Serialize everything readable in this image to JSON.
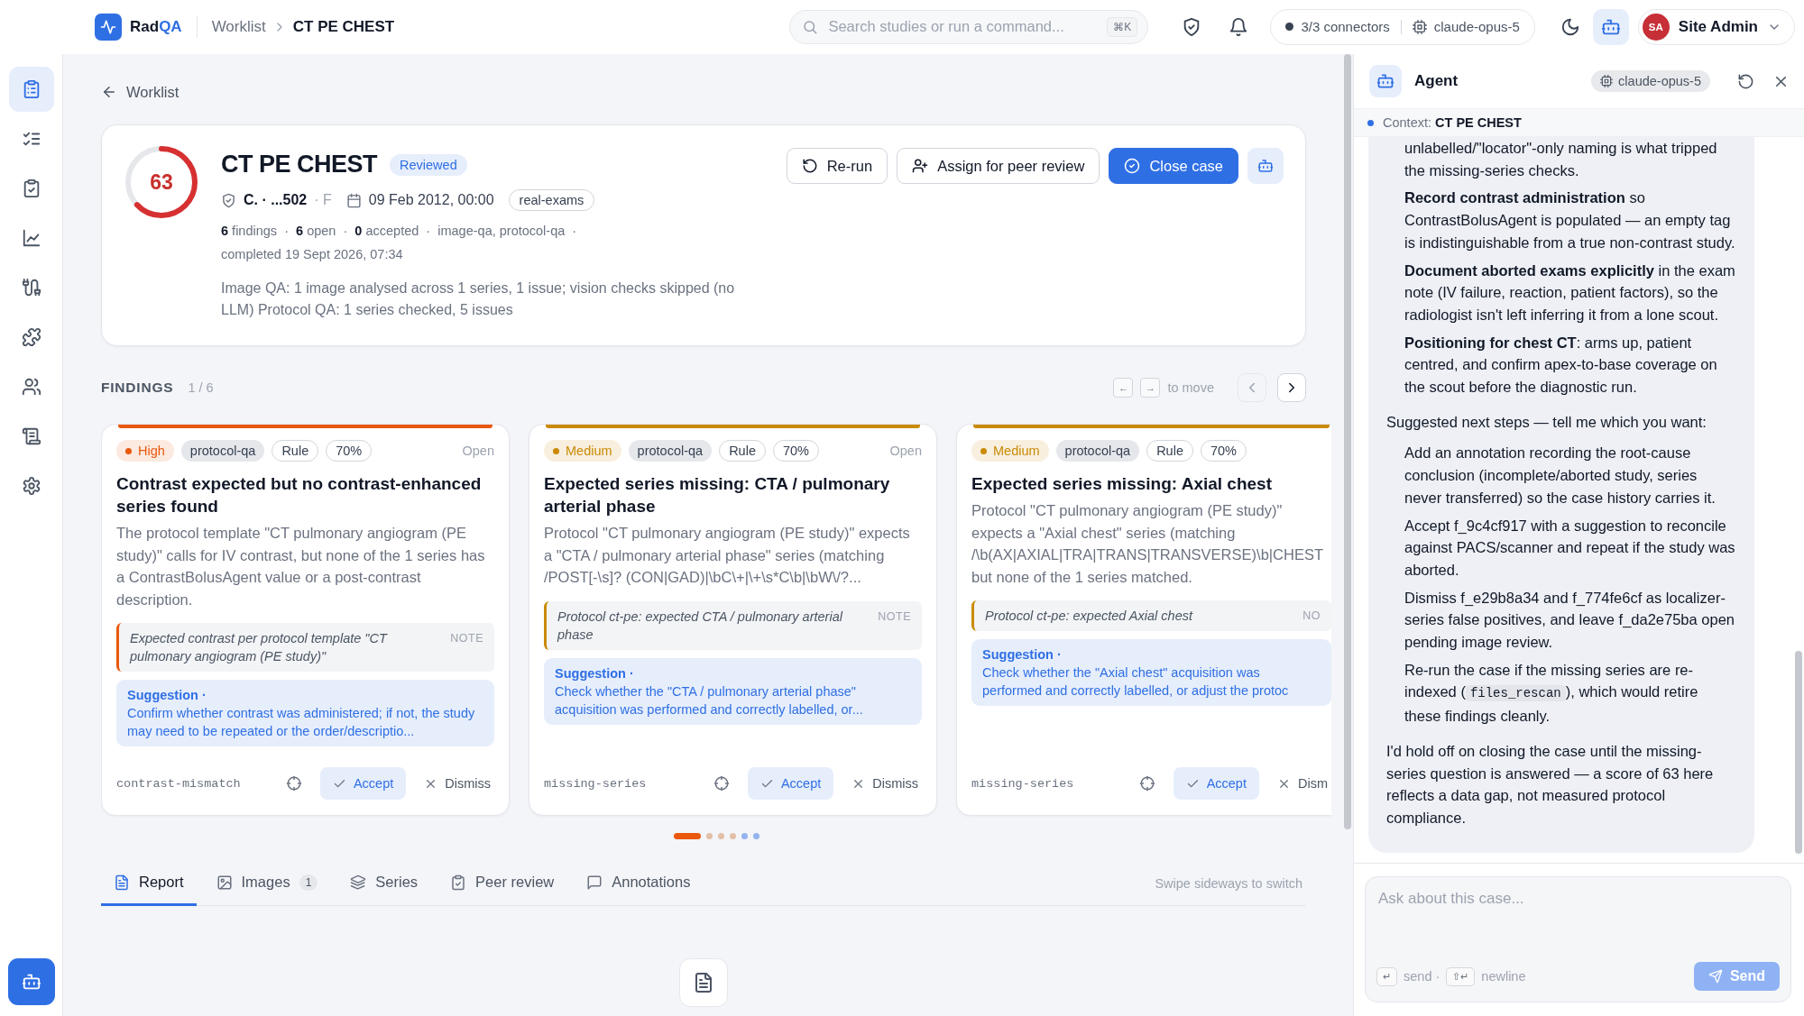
{
  "topbar": {
    "brand": {
      "text": "Rad",
      "accent": "QA"
    },
    "breadcrumb": [
      {
        "label": "Worklist",
        "current": false
      },
      {
        "label": "CT PE CHEST",
        "current": true
      }
    ],
    "search": {
      "placeholder": "Search studies or run a command...",
      "shortcut": "⌘K"
    },
    "connectors": {
      "status": "3/3 connectors",
      "model": "claude-opus-5"
    },
    "agent_toggle": {
      "on": true
    },
    "user": {
      "initials": "SA",
      "name": "Site Admin"
    }
  },
  "sidebar": {
    "items": [
      {
        "kind": "worklist",
        "selected": true
      },
      {
        "kind": "tasks",
        "selected": false
      },
      {
        "kind": "review",
        "selected": false
      },
      {
        "kind": "analytics",
        "selected": false
      },
      {
        "kind": "connectors",
        "selected": false
      },
      {
        "kind": "plugins",
        "selected": false
      },
      {
        "kind": "users",
        "selected": false
      },
      {
        "kind": "audit",
        "selected": false
      },
      {
        "kind": "settings",
        "selected": false
      }
    ]
  },
  "case": {
    "back": "Worklist",
    "score": {
      "value": "63",
      "level": 0.63
    },
    "title": "CT PE CHEST",
    "status": "Reviewed",
    "patient": "C. · ...502",
    "sex": "· F",
    "date": "09 Feb 2012, 00:00",
    "tag": "real-exams",
    "stats": "**6** findings  ·  **6** open  ·  **0** accepted  ·  image-qa, protocol-qa  ·",
    "completed": "completed 19 Sept 2026, 07:34",
    "summary": "Image QA: 1 image analysed across 1 series, 1 issue; vision checks skipped (no LLM) Protocol QA: 1 series checked, 5 issues",
    "actions": [
      {
        "kind": "rerun",
        "label": "Re-run"
      },
      {
        "kind": "assign",
        "label": "Assign for peer review"
      },
      {
        "kind": "close",
        "label": "Close case"
      },
      {
        "kind": "agent"
      }
    ]
  },
  "findings": {
    "heading": "FINDINGS",
    "position": "1 / 6",
    "keys": [
      "←",
      "→"
    ],
    "keys_hint": "to move",
    "cards": [
      {
        "severity": "High",
        "color": "#ea580c",
        "source": "protocol-qa",
        "method": "Rule",
        "confidence": "70%",
        "status": "Open",
        "title": "Contrast expected but no contrast-enhanced series found",
        "description": "The protocol template \"CT pulmonary angiogram (PE study)\" calls for IV contrast, but none of the 1 series has a ContrastBolusAgent value or a post-contrast description.",
        "note": "Expected contrast per protocol template \"CT pulmonary angiogram (PE study)\"",
        "note_label": "NOTE",
        "suggestion_label": "Suggestion ·",
        "suggestion": "Confirm whether contrast was administered; if not, the study may need to be repeated or the order/descriptio...",
        "code": "contrast-mismatch",
        "accept": "Accept",
        "dismiss": "Dismiss"
      },
      {
        "severity": "Medium",
        "color": "#ca8a04",
        "source": "protocol-qa",
        "method": "Rule",
        "confidence": "70%",
        "status": "Open",
        "title": "Expected series missing: CTA / pulmonary arterial phase",
        "description": "Protocol \"CT pulmonary angiogram (PE study)\" expects a \"CTA / pulmonary arterial phase\" series (matching /POST[-\\s]? (CON|GAD)|\\bC\\+|\\+\\s*C\\b|\\bW\\/?...",
        "note": "Protocol ct-pe: expected CTA / pulmonary arterial phase",
        "note_label": "NOTE",
        "suggestion_label": "Suggestion ·",
        "suggestion": "Check whether the \"CTA / pulmonary arterial phase\" acquisition was performed and correctly labelled, or...",
        "code": "missing-series",
        "accept": "Accept",
        "dismiss": "Dismiss"
      },
      {
        "severity": "Medium",
        "color": "#ca8a04",
        "source": "protocol-qa",
        "method": "Rule",
        "confidence": "70%",
        "title": "Expected series missing: Axial chest",
        "description": "Protocol \"CT pulmonary angiogram (PE study)\" expects a \"Axial chest\" series (matching /\\b(AX|AXIAL|TRA|TRANS|TRANSVERSE)\\b|CHEST but none of the 1 series matched.",
        "note": "Protocol ct-pe: expected Axial chest",
        "note_label": "NO",
        "suggestion_label": "Suggestion ·",
        "suggestion": "Check whether the \"Axial chest\" acquisition was performed and correctly labelled, or adjust the protoc",
        "code": "missing-series",
        "accept": "Accept",
        "dismiss": "Dism"
      }
    ],
    "dots": [
      {
        "selected": true,
        "color": "#ea580c"
      },
      {
        "selected": false,
        "color": "#e2bfa6"
      },
      {
        "selected": false,
        "color": "#e2bfa6"
      },
      {
        "selected": false,
        "color": "#e2bfa6"
      },
      {
        "selected": false,
        "color": "#93b4f0"
      },
      {
        "selected": false,
        "color": "#93b4f0"
      }
    ]
  },
  "tabs": {
    "items": [
      {
        "kind": "report",
        "label": "Report",
        "selected": true
      },
      {
        "kind": "images",
        "label": "Images",
        "count": "1",
        "selected": false
      },
      {
        "kind": "series",
        "label": "Series",
        "selected": false
      },
      {
        "kind": "peer",
        "label": "Peer review",
        "selected": false
      },
      {
        "kind": "annotations",
        "label": "Annotations",
        "selected": false
      }
    ],
    "hint": "Swipe sideways to switch"
  },
  "agent": {
    "title": "Agent",
    "model": "claude-opus-5",
    "context": "Context: **CT PE CHEST**",
    "messages": [
      {
        "kind": "item",
        "text": "unlabelled/\"locator\"-only naming is what tripped the missing-series checks."
      },
      {
        "kind": "item",
        "text": "**Record contrast administration** so ContrastBolusAgent is populated — an empty tag is indistinguishable from a true non-contrast study."
      },
      {
        "kind": "item",
        "text": "**Document aborted exams explicitly** in the exam note (IV failure, reaction, patient factors), so the radiologist isn't left inferring it from a lone scout."
      },
      {
        "kind": "item",
        "text": "**Positioning for chest CT**: arms up, patient centred, and confirm apex-to-base coverage on the scout before the diagnostic run."
      },
      {
        "kind": "paragraph",
        "text": "Suggested next steps — tell me which you want:"
      },
      {
        "kind": "item",
        "text": "Add an annotation recording the root-cause conclusion (incomplete/aborted study, series never transferred) so the case history carries it."
      },
      {
        "kind": "item",
        "text": "Accept f_9c4cf917 with a suggestion to reconcile against PACS/scanner and repeat if the study was aborted."
      },
      {
        "kind": "item",
        "text": "Dismiss f_e29b8a34 and f_774fe6cf as localizer-series false positives, and leave f_da2e75ba open pending image review."
      },
      {
        "kind": "item",
        "text": "Re-run the case if the missing series are re-indexed (",
        "code": "files_rescan",
        "after": "), which would retire these findings cleanly."
      },
      {
        "kind": "paragraph",
        "text": "I'd hold off on closing the case until the missing-series question is answered — a score of 63 here reflects a data gap, not measured protocol compliance."
      }
    ],
    "input": {
      "placeholder": "Ask about this case...",
      "keys": [
        {
          "key": "↵",
          "label": "send ·"
        },
        {
          "key": "⇧↵",
          "label": "newline"
        }
      ],
      "send": {
        "label": "Send",
        "disabled": true
      }
    }
  }
}
